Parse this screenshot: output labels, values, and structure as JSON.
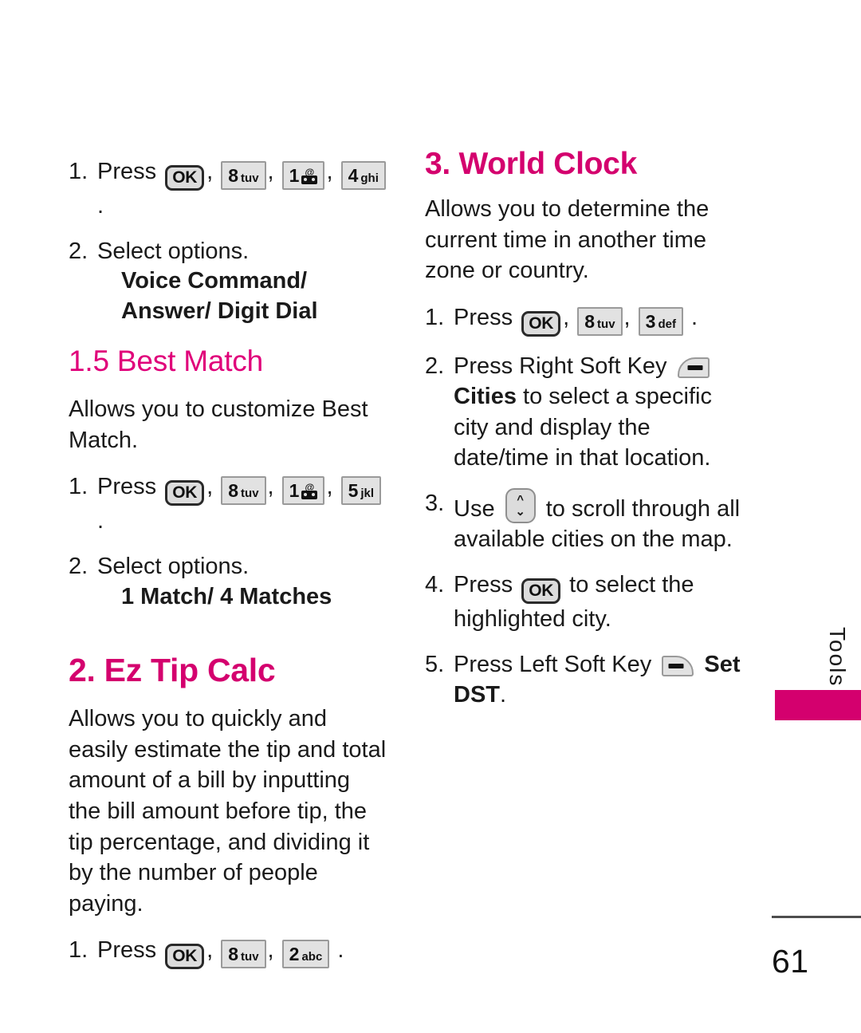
{
  "document": {
    "page_number": "61",
    "side_tab_label": "Tools",
    "accent_color": "#d4006e",
    "heading_color": "#e0007a"
  },
  "left_column": {
    "continued_steps": {
      "step1": {
        "number": "1.",
        "label": "Press",
        "trailing": "."
      },
      "step2": {
        "number": "2.",
        "label": "Select options.",
        "options": "Voice Command/ Answer/ Digit Dial"
      }
    },
    "section_best_match": {
      "heading": "1.5 Best Match",
      "description": "Allows you to customize Best Match.",
      "step1": {
        "number": "1.",
        "label": "Press",
        "trailing": "."
      },
      "step2": {
        "number": "2.",
        "label": "Select options.",
        "options": "1 Match/ 4 Matches"
      }
    },
    "section_ez_tip_calc": {
      "heading": "2. Ez Tip Calc",
      "description": "Allows you to quickly and easily estimate the tip and total amount of a bill by inputting the bill amount before tip, the tip percentage, and dividing it by the number of people paying.",
      "step1": {
        "number": "1.",
        "label": "Press",
        "trailing": "."
      }
    }
  },
  "right_column": {
    "section_world_clock": {
      "heading": "3. World Clock",
      "description": "Allows you to determine the current time in another time zone or country.",
      "step1": {
        "number": "1.",
        "label": "Press",
        "trailing": "."
      },
      "step2": {
        "number": "2.",
        "label": "Press Right Soft Key",
        "bold_term": "Cities",
        "rest": " to select a specific city and display the date/time in that location."
      },
      "step3": {
        "number": "3.",
        "label_before": "Use",
        "label_after": "to scroll through all available cities on the map."
      },
      "step4": {
        "number": "4.",
        "label_before": "Press",
        "label_after": "to select the highlighted city."
      },
      "step5": {
        "number": "5.",
        "label": "Press Left Soft Key",
        "bold_term": "Set DST",
        "trailing": "."
      }
    }
  },
  "keys": {
    "ok": "OK",
    "k8": {
      "digit": "8",
      "letters": "tuv"
    },
    "k1": {
      "digit": "1",
      "letters": "voicemail-icon"
    },
    "k2": {
      "digit": "2",
      "letters": "abc"
    },
    "k3": {
      "digit": "3",
      "letters": "def"
    },
    "k4": {
      "digit": "4",
      "letters": "ghi"
    },
    "k5": {
      "digit": "5",
      "letters": "jkl"
    }
  }
}
